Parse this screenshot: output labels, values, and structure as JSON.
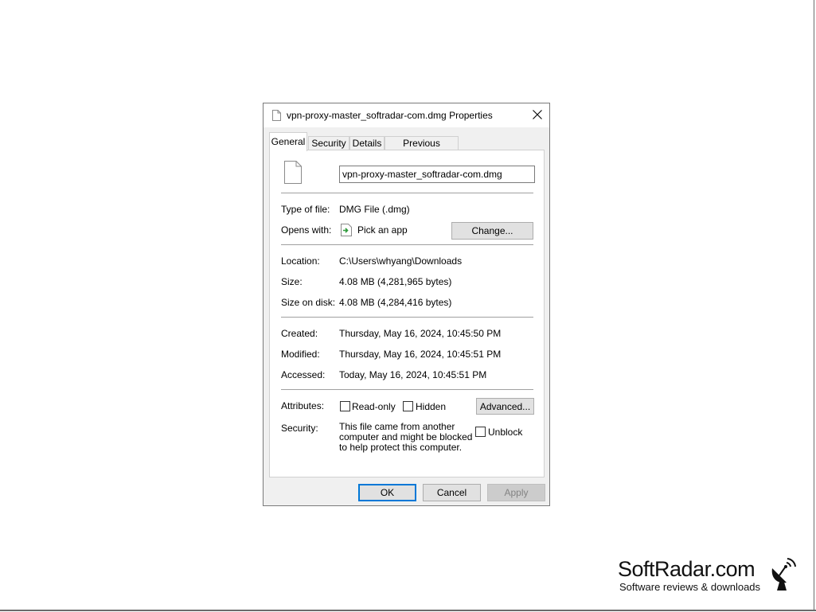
{
  "dialog": {
    "title": "vpn-proxy-master_softradar-com.dmg Properties",
    "tabs": [
      "General",
      "Security",
      "Details",
      "Previous Versions"
    ],
    "active_tab": "General",
    "file_name": "vpn-proxy-master_softradar-com.dmg",
    "type_label": "Type of file:",
    "type_value": "DMG File (.dmg)",
    "opens_label": "Opens with:",
    "opens_value": "Pick an app",
    "change_label": "Change...",
    "location_label": "Location:",
    "location_value": "C:\\Users\\whyang\\Downloads",
    "size_label": "Size:",
    "size_value": "4.08 MB (4,281,965 bytes)",
    "size_disk_label": "Size on disk:",
    "size_disk_value": "4.08 MB (4,284,416 bytes)",
    "created_label": "Created:",
    "created_value": "Thursday, May 16, 2024, 10:45:50 PM",
    "modified_label": "Modified:",
    "modified_value": "Thursday, May 16, 2024, 10:45:51 PM",
    "accessed_label": "Accessed:",
    "accessed_value": "Today, May 16, 2024, 10:45:51 PM",
    "attributes_label": "Attributes:",
    "readonly_label": "Read-only",
    "hidden_label": "Hidden",
    "advanced_label": "Advanced...",
    "security_label": "Security:",
    "security_text": "This file came from another computer and might be blocked to help protect this computer.",
    "unblock_label": "Unblock",
    "ok_label": "OK",
    "cancel_label": "Cancel",
    "apply_label": "Apply",
    "readonly_checked": false,
    "hidden_checked": false,
    "unblock_checked": false
  },
  "watermark": {
    "name": "SoftRadar.com",
    "tagline": "Software reviews & downloads",
    "icon": "satellite-dish-icon"
  },
  "colors": {
    "dialog_bg": "#f0f0f0",
    "accent": "#0078d7",
    "button_bg": "#e1e1e1"
  }
}
